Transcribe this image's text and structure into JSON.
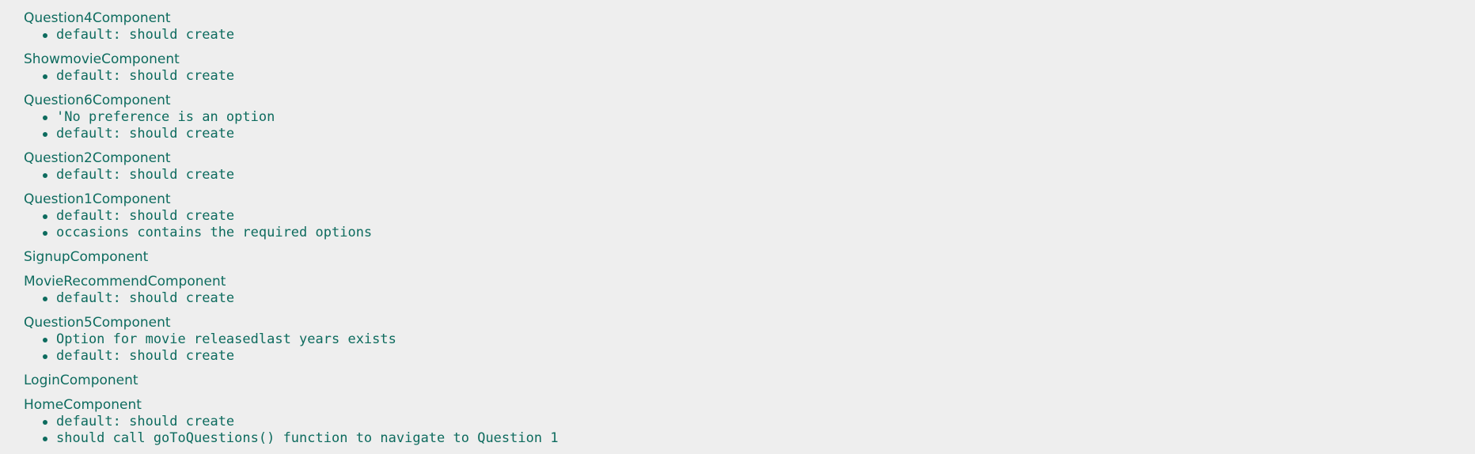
{
  "suites": [
    {
      "title": "Question4Component",
      "specs": [
        "default: should create"
      ]
    },
    {
      "title": "ShowmovieComponent",
      "specs": [
        "default: should create"
      ]
    },
    {
      "title": "Question6Component",
      "specs": [
        "'No preference is an option",
        "default: should create"
      ]
    },
    {
      "title": "Question2Component",
      "specs": [
        "default: should create"
      ]
    },
    {
      "title": "Question1Component",
      "specs": [
        "default: should create",
        "occasions contains the required options"
      ]
    },
    {
      "title": "SignupComponent",
      "specs": []
    },
    {
      "title": "MovieRecommendComponent",
      "specs": [
        "default: should create"
      ]
    },
    {
      "title": "Question5Component",
      "specs": [
        "Option for movie releasedlast years exists",
        "default: should create"
      ]
    },
    {
      "title": "LoginComponent",
      "specs": []
    },
    {
      "title": "HomeComponent",
      "specs": [
        "default: should create",
        "should call goToQuestions() function to navigate to Question 1"
      ]
    }
  ],
  "colors": {
    "background": "#eeeeee",
    "passed_text": "#0d6b5e"
  },
  "icons": {
    "spec_bullet": "bullet-icon"
  }
}
